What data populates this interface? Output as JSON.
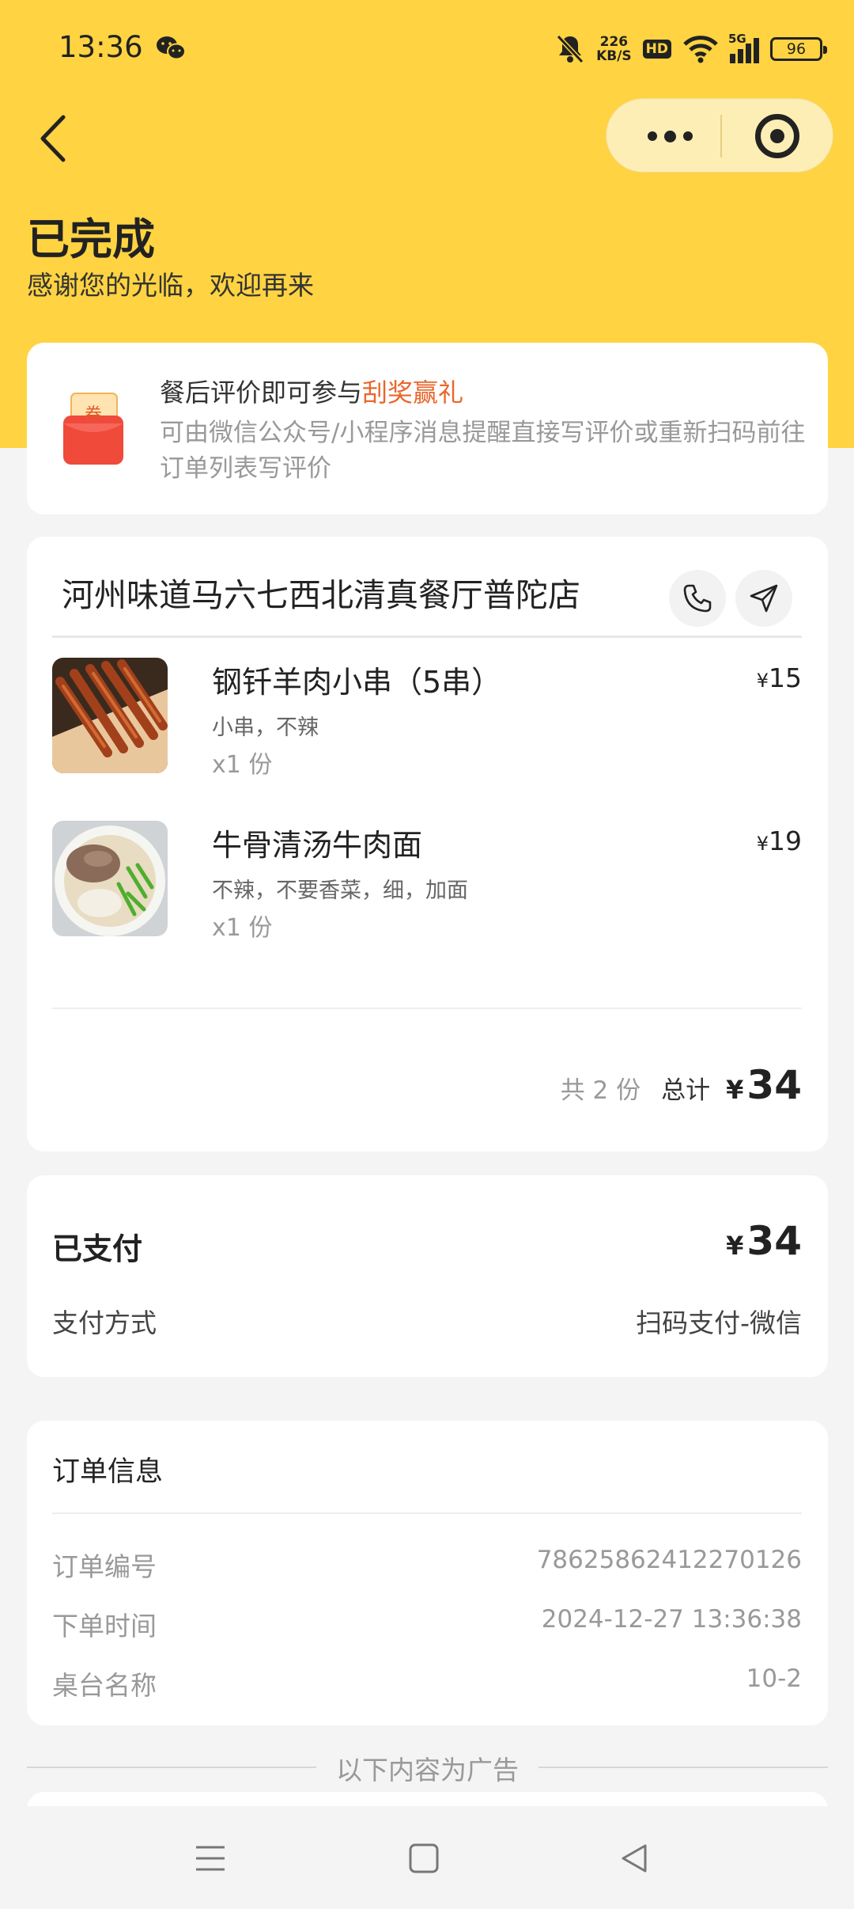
{
  "status_bar": {
    "time": "13:36",
    "net_speed_value": "226",
    "net_speed_unit": "KB/S",
    "hd": "HD",
    "signal": "5G",
    "battery": "96"
  },
  "header": {
    "title": "已完成",
    "subtitle": "感谢您的光临，欢迎再来"
  },
  "promo": {
    "coupon_text": "券",
    "title_prefix": "餐后评价即可参与",
    "title_highlight": "刮奖赢礼",
    "description": "可由微信公众号/小程序消息提醒直接写评价或重新扫码前往订单列表写评价"
  },
  "order": {
    "store_name": "河州味道马六七西北清真餐厅普陀店",
    "items": [
      {
        "name": "钢钎羊肉小串（5串）",
        "spec": "小串，不辣",
        "qty": "x1 份",
        "currency": "¥",
        "price": "15"
      },
      {
        "name": "牛骨清汤牛肉面",
        "spec": "不辣，不要香菜，细，加面",
        "qty": "x1 份",
        "currency": "¥",
        "price": "19"
      }
    ],
    "total_count": "共 2 份",
    "total_label": "总计",
    "total_currency": "¥",
    "total_amount": "34"
  },
  "payment": {
    "status": "已支付",
    "currency": "¥",
    "amount": "34",
    "method_label": "支付方式",
    "method_value": "扫码支付-微信"
  },
  "order_info": {
    "title": "订单信息",
    "rows": [
      {
        "key": "订单编号",
        "value": "78625862412270126"
      },
      {
        "key": "下单时间",
        "value": "2024-12-27 13:36:38"
      },
      {
        "key": "桌台名称",
        "value": "10-2"
      }
    ]
  },
  "ad_label": "以下内容为广告",
  "colors": {
    "header_bg": "#ffd341",
    "highlight": "#e9662c",
    "page_bg": "#f4f4f4"
  },
  "icons": [
    "wechat-icon",
    "mute-bell-icon",
    "wifi-icon",
    "signal-icon",
    "battery-icon",
    "back-icon",
    "more-icon",
    "target-icon",
    "coupon-icon",
    "phone-icon",
    "navigation-icon",
    "menu-icon",
    "home-icon",
    "back-nav-icon"
  ]
}
